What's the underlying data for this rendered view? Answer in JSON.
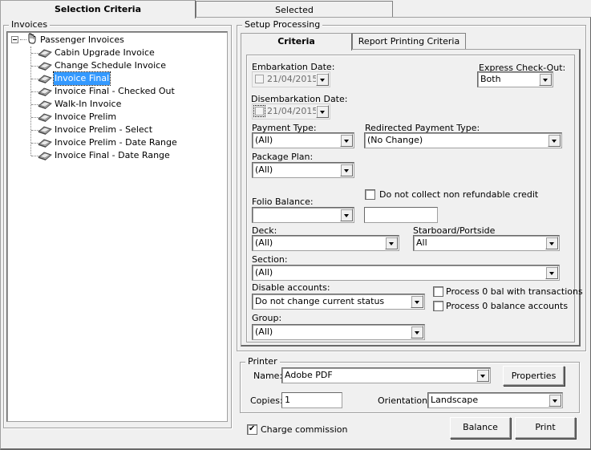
{
  "top_tabs": [
    {
      "label": "Selection Criteria",
      "active": true
    },
    {
      "label": "Selected",
      "active": false
    }
  ],
  "invoices_group": {
    "title": "Invoices",
    "root": {
      "label": "Passenger Invoices",
      "icon": "hand-icon",
      "expanded": true
    },
    "items": [
      {
        "label": "Cabin Upgrade Invoice",
        "selected": false
      },
      {
        "label": "Change Schedule Invoice",
        "selected": false
      },
      {
        "label": "Invoice Final",
        "selected": true
      },
      {
        "label": "Invoice Final - Checked Out",
        "selected": false
      },
      {
        "label": "Walk-In Invoice",
        "selected": false
      },
      {
        "label": "Invoice Prelim",
        "selected": false
      },
      {
        "label": "Invoice Prelim - Select",
        "selected": false
      },
      {
        "label": "Invoice Prelim - Date Range",
        "selected": false
      },
      {
        "label": "Invoice Final - Date Range",
        "selected": false
      }
    ]
  },
  "setup_group": {
    "title": "Setup Processing",
    "tabs": [
      {
        "label": "Criteria",
        "active": true
      },
      {
        "label": "Report Printing Criteria",
        "active": false
      }
    ]
  },
  "criteria": {
    "embarkation_date": {
      "label": "Embarkation Date:",
      "value": "21/04/2015",
      "checked": false
    },
    "express_checkout": {
      "label": "Express Check-Out:",
      "value": "Both"
    },
    "disembarkation_date": {
      "label": "Disembarkation Date:",
      "value": "21/04/2015",
      "checked": false
    },
    "payment_type": {
      "label": "Payment Type:",
      "value": "(All)"
    },
    "redirected_payment_type": {
      "label": "Redirected Payment Type:",
      "value": "(No Change)"
    },
    "package_plan": {
      "label": "Package Plan:",
      "value": "(All)"
    },
    "do_not_collect": {
      "label": "Do not collect non refundable credit",
      "checked": false
    },
    "folio_balance": {
      "label": "Folio Balance:",
      "value": "",
      "amount": ""
    },
    "deck": {
      "label": "Deck:",
      "value": "(All)"
    },
    "starboard_portside": {
      "label": "Starboard/Portside",
      "value": "All"
    },
    "section": {
      "label": "Section:",
      "value": "(All)"
    },
    "disable_accounts": {
      "label": "Disable accounts:",
      "value": "Do not change current status"
    },
    "process_zero_bal_trans": {
      "label": "Process 0 bal with transactions",
      "checked": false
    },
    "process_zero_balance": {
      "label": "Process 0 balance accounts",
      "checked": false
    },
    "group": {
      "label": "Group:",
      "value": "(All)"
    }
  },
  "printer": {
    "title": "Printer",
    "name_label": "Name:",
    "name_value": "Adobe PDF",
    "properties_label": "Properties",
    "copies_label": "Copies:",
    "copies_value": "1",
    "orientation_label": "Orientation:",
    "orientation_value": "Landscape"
  },
  "footer": {
    "charge_commission": {
      "label": "Charge commission",
      "checked": true
    },
    "balance_label": "Balance",
    "print_label": "Print"
  }
}
